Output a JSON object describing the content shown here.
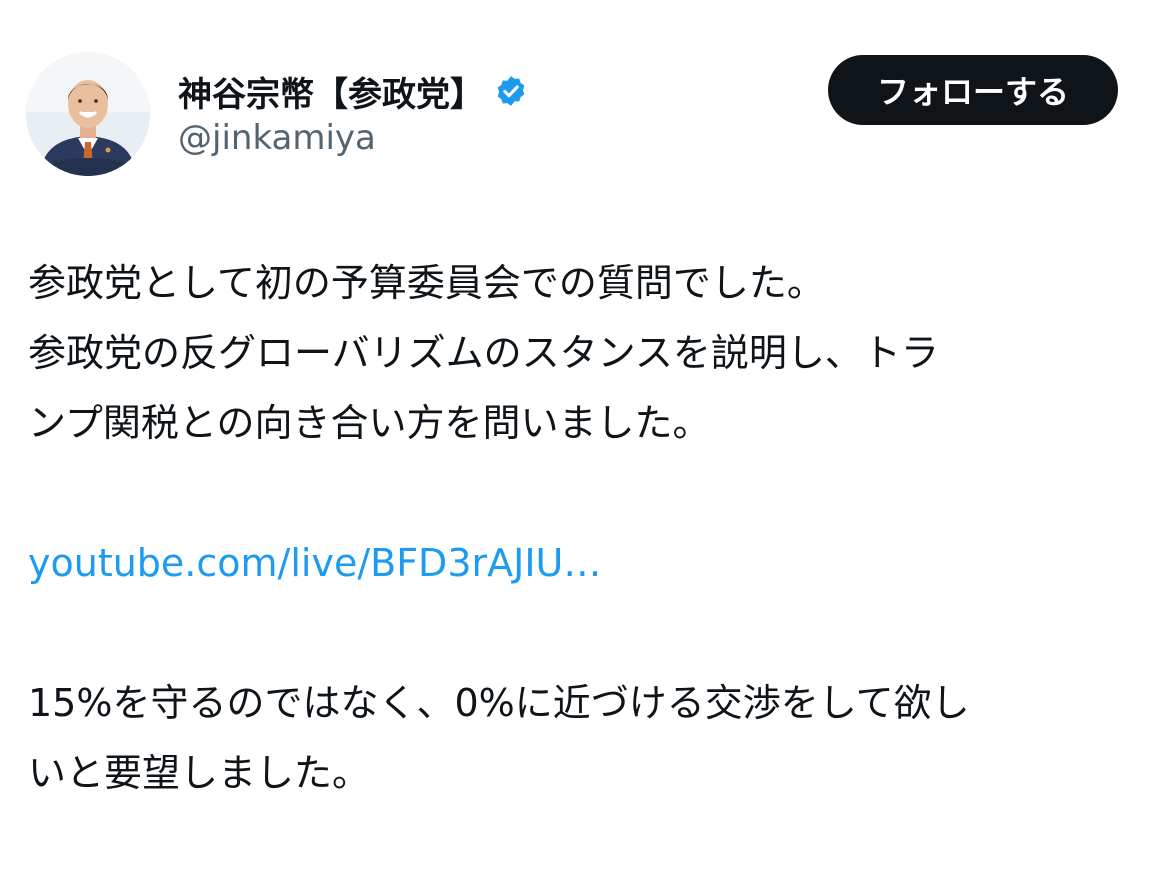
{
  "author": {
    "display_name": "神谷宗幣【参政党】",
    "handle": "@jinkamiya",
    "verified_icon": "verified-badge-icon",
    "avatar_icon": "profile-photo"
  },
  "follow_button": {
    "label": "フォローする"
  },
  "post": {
    "line1": "参政党として初の予算委員会での質問でした。",
    "line2": "参政党の反グローバリズムのスタンスを説明し、トラ",
    "line3": "ンプ関税との向き合い方を問いました。",
    "link_text": "youtube.com/live/BFD3rAJIU…",
    "line4": "15%を守るのではなく、0%に近づける交渉をして欲し",
    "line5": "いと要望しました。"
  },
  "colors": {
    "text": "#0f1419",
    "secondary": "#536471",
    "link": "#1d9bf0",
    "verified": "#1d9bf0",
    "button_bg": "#0f1419"
  }
}
